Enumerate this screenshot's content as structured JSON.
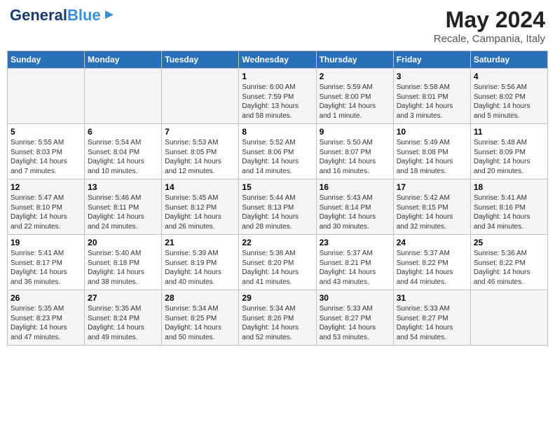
{
  "header": {
    "logo_line1": "General",
    "logo_line2": "Blue",
    "month": "May 2024",
    "location": "Recale, Campania, Italy"
  },
  "weekdays": [
    "Sunday",
    "Monday",
    "Tuesday",
    "Wednesday",
    "Thursday",
    "Friday",
    "Saturday"
  ],
  "weeks": [
    [
      {
        "day": "",
        "info": ""
      },
      {
        "day": "",
        "info": ""
      },
      {
        "day": "",
        "info": ""
      },
      {
        "day": "1",
        "info": "Sunrise: 6:00 AM\nSunset: 7:59 PM\nDaylight: 13 hours\nand 58 minutes."
      },
      {
        "day": "2",
        "info": "Sunrise: 5:59 AM\nSunset: 8:00 PM\nDaylight: 14 hours\nand 1 minute."
      },
      {
        "day": "3",
        "info": "Sunrise: 5:58 AM\nSunset: 8:01 PM\nDaylight: 14 hours\nand 3 minutes."
      },
      {
        "day": "4",
        "info": "Sunrise: 5:56 AM\nSunset: 8:02 PM\nDaylight: 14 hours\nand 5 minutes."
      }
    ],
    [
      {
        "day": "5",
        "info": "Sunrise: 5:55 AM\nSunset: 8:03 PM\nDaylight: 14 hours\nand 7 minutes."
      },
      {
        "day": "6",
        "info": "Sunrise: 5:54 AM\nSunset: 8:04 PM\nDaylight: 14 hours\nand 10 minutes."
      },
      {
        "day": "7",
        "info": "Sunrise: 5:53 AM\nSunset: 8:05 PM\nDaylight: 14 hours\nand 12 minutes."
      },
      {
        "day": "8",
        "info": "Sunrise: 5:52 AM\nSunset: 8:06 PM\nDaylight: 14 hours\nand 14 minutes."
      },
      {
        "day": "9",
        "info": "Sunrise: 5:50 AM\nSunset: 8:07 PM\nDaylight: 14 hours\nand 16 minutes."
      },
      {
        "day": "10",
        "info": "Sunrise: 5:49 AM\nSunset: 8:08 PM\nDaylight: 14 hours\nand 18 minutes."
      },
      {
        "day": "11",
        "info": "Sunrise: 5:48 AM\nSunset: 8:09 PM\nDaylight: 14 hours\nand 20 minutes."
      }
    ],
    [
      {
        "day": "12",
        "info": "Sunrise: 5:47 AM\nSunset: 8:10 PM\nDaylight: 14 hours\nand 22 minutes."
      },
      {
        "day": "13",
        "info": "Sunrise: 5:46 AM\nSunset: 8:11 PM\nDaylight: 14 hours\nand 24 minutes."
      },
      {
        "day": "14",
        "info": "Sunrise: 5:45 AM\nSunset: 8:12 PM\nDaylight: 14 hours\nand 26 minutes."
      },
      {
        "day": "15",
        "info": "Sunrise: 5:44 AM\nSunset: 8:13 PM\nDaylight: 14 hours\nand 28 minutes."
      },
      {
        "day": "16",
        "info": "Sunrise: 5:43 AM\nSunset: 8:14 PM\nDaylight: 14 hours\nand 30 minutes."
      },
      {
        "day": "17",
        "info": "Sunrise: 5:42 AM\nSunset: 8:15 PM\nDaylight: 14 hours\nand 32 minutes."
      },
      {
        "day": "18",
        "info": "Sunrise: 5:41 AM\nSunset: 8:16 PM\nDaylight: 14 hours\nand 34 minutes."
      }
    ],
    [
      {
        "day": "19",
        "info": "Sunrise: 5:41 AM\nSunset: 8:17 PM\nDaylight: 14 hours\nand 36 minutes."
      },
      {
        "day": "20",
        "info": "Sunrise: 5:40 AM\nSunset: 8:18 PM\nDaylight: 14 hours\nand 38 minutes."
      },
      {
        "day": "21",
        "info": "Sunrise: 5:39 AM\nSunset: 8:19 PM\nDaylight: 14 hours\nand 40 minutes."
      },
      {
        "day": "22",
        "info": "Sunrise: 5:38 AM\nSunset: 8:20 PM\nDaylight: 14 hours\nand 41 minutes."
      },
      {
        "day": "23",
        "info": "Sunrise: 5:37 AM\nSunset: 8:21 PM\nDaylight: 14 hours\nand 43 minutes."
      },
      {
        "day": "24",
        "info": "Sunrise: 5:37 AM\nSunset: 8:22 PM\nDaylight: 14 hours\nand 44 minutes."
      },
      {
        "day": "25",
        "info": "Sunrise: 5:36 AM\nSunset: 8:22 PM\nDaylight: 14 hours\nand 46 minutes."
      }
    ],
    [
      {
        "day": "26",
        "info": "Sunrise: 5:35 AM\nSunset: 8:23 PM\nDaylight: 14 hours\nand 47 minutes."
      },
      {
        "day": "27",
        "info": "Sunrise: 5:35 AM\nSunset: 8:24 PM\nDaylight: 14 hours\nand 49 minutes."
      },
      {
        "day": "28",
        "info": "Sunrise: 5:34 AM\nSunset: 8:25 PM\nDaylight: 14 hours\nand 50 minutes."
      },
      {
        "day": "29",
        "info": "Sunrise: 5:34 AM\nSunset: 8:26 PM\nDaylight: 14 hours\nand 52 minutes."
      },
      {
        "day": "30",
        "info": "Sunrise: 5:33 AM\nSunset: 8:27 PM\nDaylight: 14 hours\nand 53 minutes."
      },
      {
        "day": "31",
        "info": "Sunrise: 5:33 AM\nSunset: 8:27 PM\nDaylight: 14 hours\nand 54 minutes."
      },
      {
        "day": "",
        "info": ""
      }
    ]
  ]
}
